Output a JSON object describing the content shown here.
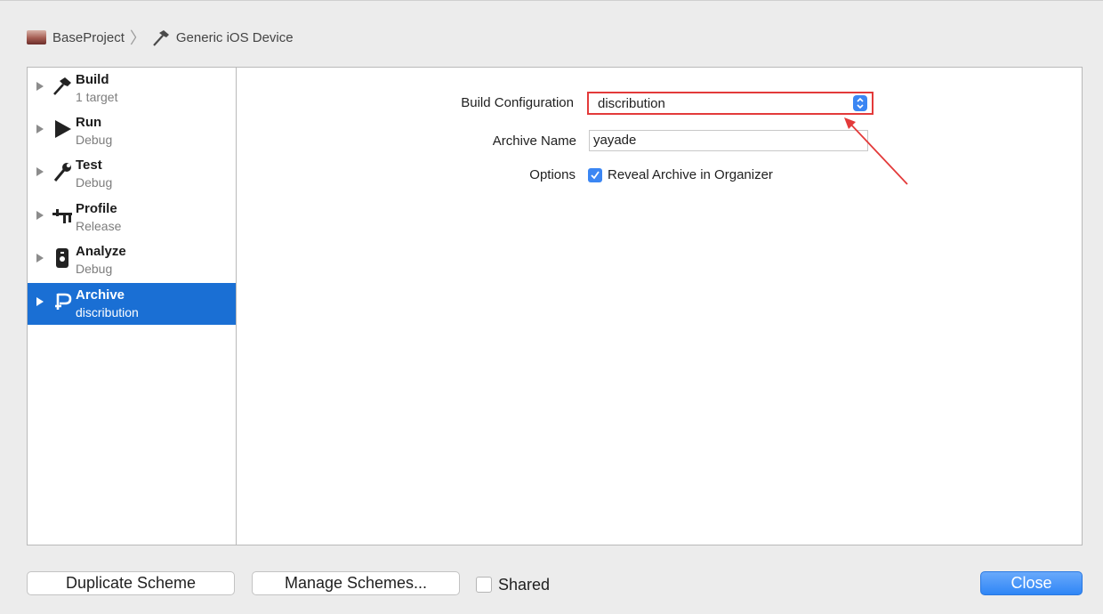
{
  "breadcrumb": {
    "project": "BaseProject",
    "device": "Generic iOS Device"
  },
  "sidebar": {
    "items": [
      {
        "title": "Build",
        "subtitle": "1 target",
        "icon": "hammer-icon"
      },
      {
        "title": "Run",
        "subtitle": "Debug",
        "icon": "play-icon"
      },
      {
        "title": "Test",
        "subtitle": "Debug",
        "icon": "wrench-icon"
      },
      {
        "title": "Profile",
        "subtitle": "Release",
        "icon": "instruments-icon"
      },
      {
        "title": "Analyze",
        "subtitle": "Debug",
        "icon": "analyze-icon"
      },
      {
        "title": "Archive",
        "subtitle": "discribution",
        "icon": "archive-icon",
        "selected": true
      }
    ]
  },
  "main": {
    "build_configuration_label": "Build Configuration",
    "build_configuration_value": "discribution",
    "archive_name_label": "Archive Name",
    "archive_name_value": "yayade",
    "options_label": "Options",
    "reveal_archive_label": "Reveal Archive in Organizer",
    "reveal_archive_checked": true
  },
  "footer": {
    "duplicate_scheme": "Duplicate Scheme",
    "manage_schemes": "Manage Schemes...",
    "shared_label": "Shared",
    "shared_checked": false,
    "close": "Close"
  },
  "colors": {
    "selection": "#1a6fd4",
    "accent": "#3b86f3",
    "highlight": "#e33a3a"
  }
}
